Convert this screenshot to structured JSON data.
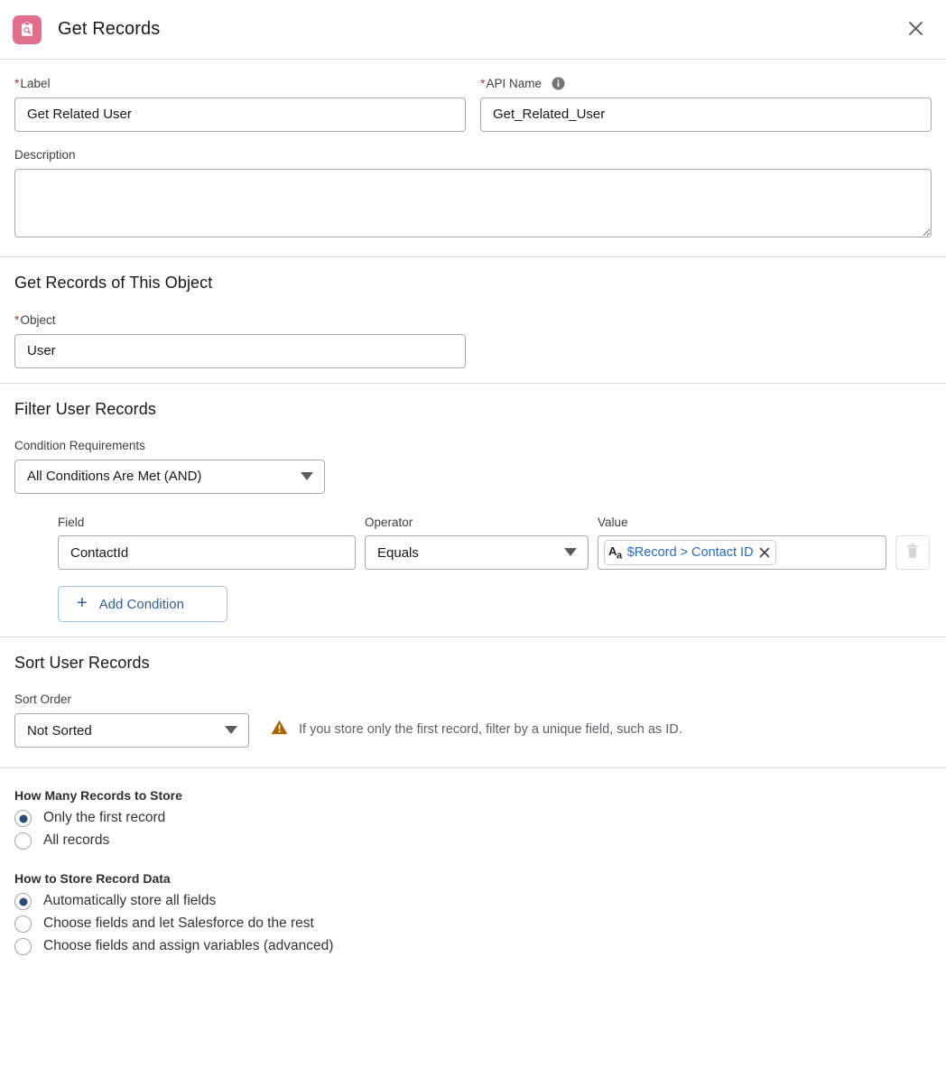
{
  "header": {
    "title": "Get Records",
    "icon": "get-records-clipboard-search-icon",
    "icon_color": "#e16e8c",
    "close_label": "Close"
  },
  "basics": {
    "label_field": {
      "label": "Label",
      "required_marker": "*",
      "value": "Get Related User"
    },
    "api_name_field": {
      "label": "API Name",
      "required_marker": "*",
      "value": "Get_Related_User",
      "info_icon": "info-icon"
    },
    "description_field": {
      "label": "Description",
      "value": ""
    }
  },
  "object_section": {
    "title": "Get Records of This Object",
    "object_field": {
      "label": "Object",
      "required_marker": "*",
      "value": "User"
    }
  },
  "filter_section": {
    "title": "Filter User Records",
    "condition_requirements": {
      "label": "Condition Requirements",
      "value": "All Conditions Are Met (AND)"
    },
    "columns": {
      "field": "Field",
      "operator": "Operator",
      "value": "Value"
    },
    "conditions": [
      {
        "field": "ContactId",
        "operator": "Equals",
        "value_pill": {
          "type_icon": "text-type-Aa-icon",
          "text": "$Record > Contact ID",
          "remove_icon": "close-icon"
        },
        "delete_icon": "trash-icon",
        "delete_disabled": true
      }
    ],
    "add_condition_label": "Add Condition",
    "add_condition_icon": "plus-icon"
  },
  "sort_section": {
    "title": "Sort User Records",
    "sort_order": {
      "label": "Sort Order",
      "value": "Not Sorted"
    },
    "warning": {
      "icon": "warning-triangle-icon",
      "color": "#a86403",
      "text": "If you store only the first record, filter by a unique field, such as ID."
    }
  },
  "storage_section": {
    "how_many": {
      "title": "How Many Records to Store",
      "options": [
        {
          "label": "Only the first record",
          "selected": true
        },
        {
          "label": "All records",
          "selected": false
        }
      ]
    },
    "how_to_store": {
      "title": "How to Store Record Data",
      "options": [
        {
          "label": "Automatically store all fields",
          "selected": true
        },
        {
          "label": "Choose fields and let Salesforce do the rest",
          "selected": false
        },
        {
          "label": "Choose fields and assign variables (advanced)",
          "selected": false
        }
      ]
    }
  },
  "colors": {
    "accent_link": "#2b6bb5",
    "required_red": "#b03b28",
    "header_icon": "#e16e8c",
    "radio_selected": "#2b4a78",
    "warning": "#a86403",
    "border": "#a8a8a8"
  }
}
